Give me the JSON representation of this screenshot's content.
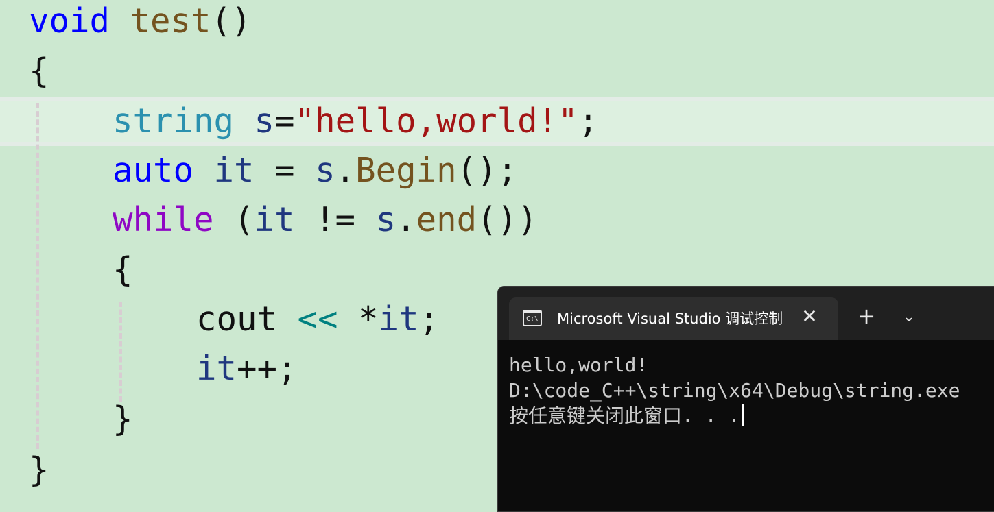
{
  "editor": {
    "lines": [
      {
        "tokens": [
          {
            "t": "void",
            "c": "kw"
          },
          {
            "t": " ",
            "c": "pl"
          },
          {
            "t": "test",
            "c": "fn"
          },
          {
            "t": "()",
            "c": "pl"
          }
        ]
      },
      {
        "tokens": [
          {
            "t": "{",
            "c": "pl"
          }
        ]
      },
      {
        "tokens": [
          {
            "t": "string",
            "c": "ty"
          },
          {
            "t": " ",
            "c": "pl"
          },
          {
            "t": "s",
            "c": "vr"
          },
          {
            "t": "=",
            "c": "pl"
          },
          {
            "t": "\"hello,world!\"",
            "c": "st"
          },
          {
            "t": ";",
            "c": "pl"
          }
        ]
      },
      {
        "tokens": [
          {
            "t": "auto",
            "c": "kw"
          },
          {
            "t": " ",
            "c": "pl"
          },
          {
            "t": "it",
            "c": "vr"
          },
          {
            "t": " = ",
            "c": "pl"
          },
          {
            "t": "s",
            "c": "vr"
          },
          {
            "t": ".",
            "c": "pl"
          },
          {
            "t": "Begin",
            "c": "fn"
          },
          {
            "t": "();",
            "c": "pl"
          }
        ]
      },
      {
        "tokens": [
          {
            "t": "while",
            "c": "ctl"
          },
          {
            "t": " (",
            "c": "pl"
          },
          {
            "t": "it",
            "c": "vr"
          },
          {
            "t": " != ",
            "c": "pl"
          },
          {
            "t": "s",
            "c": "vr"
          },
          {
            "t": ".",
            "c": "pl"
          },
          {
            "t": "end",
            "c": "fn"
          },
          {
            "t": "())",
            "c": "pl"
          }
        ]
      },
      {
        "tokens": [
          {
            "t": "{",
            "c": "pl"
          }
        ]
      },
      {
        "tokens": [
          {
            "t": "cout",
            "c": "pl"
          },
          {
            "t": " ",
            "c": "pl"
          },
          {
            "t": "<<",
            "c": "op"
          },
          {
            "t": " *",
            "c": "pl"
          },
          {
            "t": "it",
            "c": "vr"
          },
          {
            "t": ";",
            "c": "pl"
          }
        ]
      },
      {
        "tokens": [
          {
            "t": "it",
            "c": "vr"
          },
          {
            "t": "++;",
            "c": "pl"
          }
        ]
      },
      {
        "tokens": [
          {
            "t": "}",
            "c": "pl"
          }
        ]
      },
      {
        "tokens": [
          {
            "t": "}",
            "c": "pl"
          }
        ]
      }
    ]
  },
  "terminal": {
    "tab_title": "Microsoft Visual Studio 调试控制台",
    "icon_glyph": "C:\\",
    "close_glyph": "✕",
    "new_tab_glyph": "+",
    "dropdown_glyph": "⌄",
    "output_line1": "hello,world!",
    "output_line2": "D:\\code_C++\\string\\x64\\Debug\\string.exe",
    "output_line3": "按任意键关闭此窗口. . ."
  },
  "colors": {
    "editor_background": "#cce8d0",
    "keyword": "#0000ff",
    "function": "#74531f",
    "type": "#2b91af",
    "variable": "#1f377f",
    "string": "#a31515",
    "control_keyword": "#8f08c4",
    "operator": "#008080",
    "terminal_background": "#0c0c0c"
  }
}
